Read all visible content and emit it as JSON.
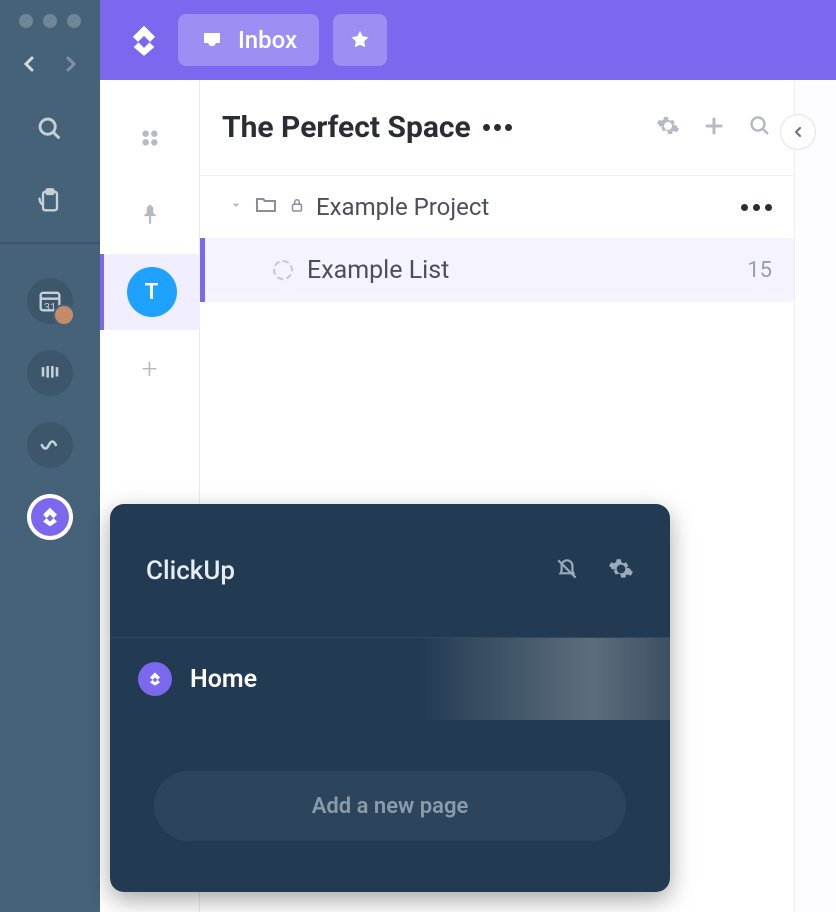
{
  "topbar": {
    "inbox_label": "Inbox"
  },
  "mini_rail": {
    "team_letter": "T"
  },
  "space": {
    "title": "The Perfect Space",
    "project": {
      "name": "Example Project"
    },
    "list": {
      "name": "Example List",
      "count": "15"
    }
  },
  "popover": {
    "title": "ClickUp",
    "home_label": "Home",
    "add_label": "Add a new page"
  }
}
